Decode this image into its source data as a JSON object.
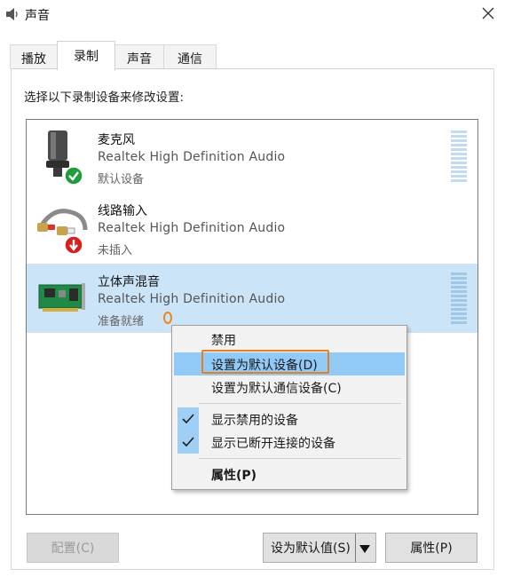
{
  "window": {
    "title": "声音",
    "close_icon": "close-icon",
    "title_icon": "speaker-icon"
  },
  "tabs": [
    {
      "label": "播放",
      "active": false
    },
    {
      "label": "录制",
      "active": true
    },
    {
      "label": "声音",
      "active": false
    },
    {
      "label": "通信",
      "active": false
    }
  ],
  "instruction": "选择以下录制设备来修改设置:",
  "devices": [
    {
      "name": "麦克风",
      "driver": "Realtek High Definition Audio",
      "status": "默认设备",
      "icon": "microphone-icon",
      "badge": "default-check-icon",
      "selected": false
    },
    {
      "name": "线路输入",
      "driver": "Realtek High Definition Audio",
      "status": "未插入",
      "icon": "line-in-icon",
      "badge": "unplugged-arrow-icon",
      "selected": false
    },
    {
      "name": "立体声混音",
      "driver": "Realtek High Definition Audio",
      "status": "准备就绪",
      "icon": "sound-card-icon",
      "selected": true
    }
  ],
  "context_menu": {
    "items": [
      {
        "label": "禁用",
        "checked": false
      },
      {
        "label": "设置为默认设备(D)",
        "checked": false,
        "hover": true
      },
      {
        "label": "设置为默认通信设备(C)",
        "checked": false
      },
      {
        "label": "显示禁用的设备",
        "checked": true
      },
      {
        "label": "显示已断开连接的设备",
        "checked": true
      },
      {
        "label": "属性(P)",
        "checked": false,
        "bold": true
      }
    ]
  },
  "buttons": {
    "configure": "配置(C)",
    "set_default": "设为默认值(S)",
    "properties": "属性(P)"
  },
  "colors": {
    "selection": "#cce4f7",
    "menu_hover": "#91c9f7",
    "highlight_box": "#e8801f",
    "check_green": "#1e9e3b",
    "unplug_red": "#d81e1e"
  }
}
